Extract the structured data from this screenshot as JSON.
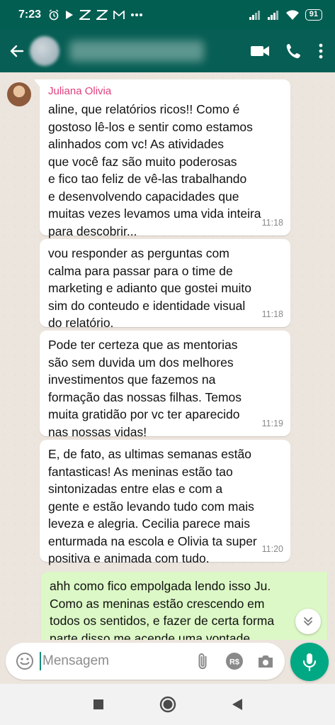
{
  "status_bar": {
    "time": "7:23",
    "battery": "91",
    "notification_icons": [
      "alarm-icon",
      "play-icon",
      "app-icon",
      "app-icon",
      "gmail-icon",
      "more-dots-icon"
    ],
    "system_icons": [
      "signal-icon",
      "signal-icon",
      "wifi-icon",
      "battery-icon"
    ]
  },
  "header": {
    "contact_name": "",
    "actions": [
      "video-call-icon",
      "phone-icon",
      "more-vert-icon"
    ]
  },
  "messages": [
    {
      "sender": "Juliana Olivia",
      "text": "aline, que relatórios ricos!! Como é\ngostoso lê-los e sentir como estamos\nalinhados com vc! As atividades\nque você faz são muito poderosas\ne fico tao feliz de vê-las trabalhando\ne desenvolvendo capacidades que\nmuitas vezes levamos uma vida inteira\npara descobrir...",
      "time": "11:18"
    },
    {
      "text": "vou responder as perguntas com\ncalma para passar para o time de\nmarketing e adianto que gostei muito\nsim do conteudo e identidade visual\ndo relatório.",
      "time": "11:18"
    },
    {
      "text": "Pode ter certeza que as mentorias\nsão sem duvida um dos melhores\ninvestimentos que fazemos na\nformação das nossas filhas. Temos\nmuita gratidão por vc ter aparecido\nnas nossas vidas!",
      "time": "11:19"
    },
    {
      "text": "E, de fato, as ultimas semanas estão\nfantasticas! As meninas estão tao\nsintonizadas entre elas e com a\ngente e estão levando tudo com mais\nleveza e alegria. Cecilia parece mais\nenturmada na escola e Olivia ta super\npositiva e animada com tudo.",
      "time": "11:20"
    },
    {
      "text": "ahh como fico empolgada lendo isso Ju.\nComo as meninas estão crescendo em\ntodos os sentidos, e fazer de certa forma\nparte disso me acende uma vontade"
    }
  ],
  "composer": {
    "placeholder": "Mensagem",
    "icons": [
      "emoji-icon",
      "attach-icon",
      "payment-icon",
      "camera-icon",
      "mic-icon"
    ]
  },
  "colors": {
    "header": "#075e54",
    "status_bar": "#035e52",
    "outgoing_bubble": "#dcf8c6",
    "incoming_bubble": "#ffffff",
    "sender_name": "#e0407d",
    "accent": "#00a884",
    "chat_background": "#ece5dd"
  }
}
